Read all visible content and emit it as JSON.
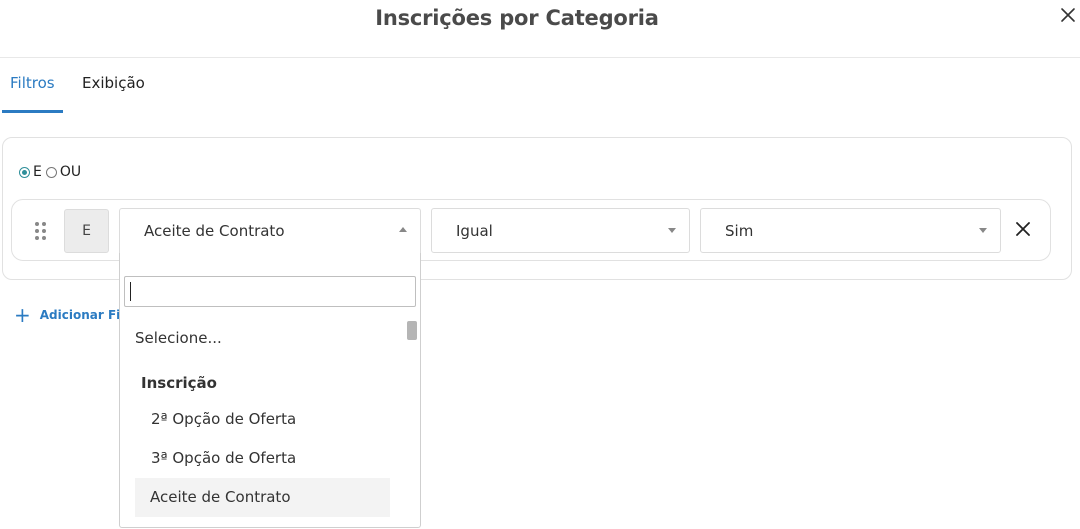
{
  "modal": {
    "title": "Inscrições por Categoria",
    "close_icon": "close-icon"
  },
  "tabs": [
    {
      "label": "Filtros",
      "active": true
    },
    {
      "label": "Exibição",
      "active": false
    }
  ],
  "colors": {
    "accent": "#2b7bc2",
    "radio_checked": "#2f8f9a",
    "selected_option_bg": "#f3f3f3"
  },
  "logic": {
    "options": [
      {
        "label": "E",
        "checked": true
      },
      {
        "label": "OU",
        "checked": false
      }
    ]
  },
  "rule": {
    "drag_icon": "drag-handle-icon",
    "conjunction": "E",
    "field": "Aceite de Contrato",
    "operator": "Igual",
    "value": "Sim",
    "remove_icon": "close-icon"
  },
  "add_filter": {
    "icon": "plus-icon",
    "label": "Adicionar Filtro"
  },
  "dropdown": {
    "search_value": "",
    "placeholder_option": "Selecione...",
    "group_label": "Inscrição",
    "options": [
      "2ª Opção de Oferta",
      "3ª Opção de Oferta",
      "Aceite de Contrato"
    ],
    "selected": "Aceite de Contrato"
  }
}
